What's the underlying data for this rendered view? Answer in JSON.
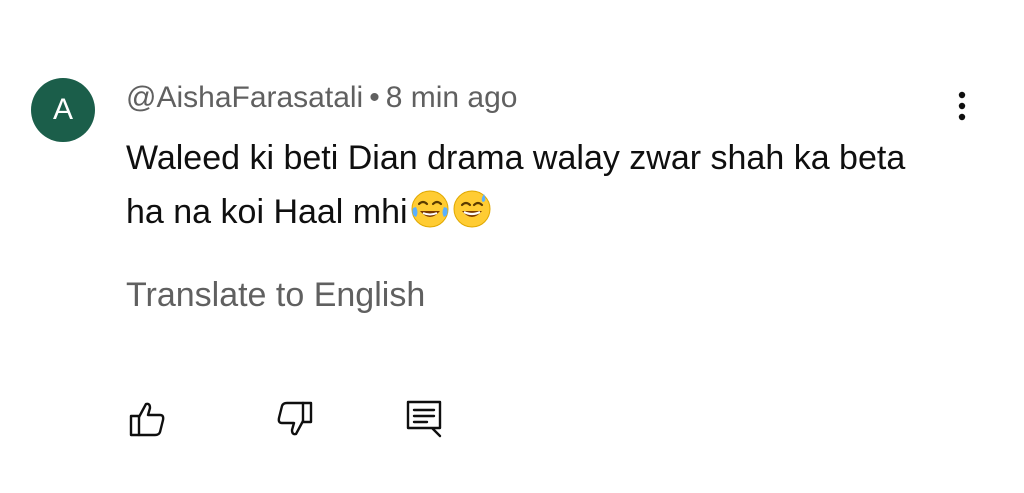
{
  "comment": {
    "avatar": {
      "initial": "A",
      "color": "#1b5e4a"
    },
    "author": "@AishaFarasatali",
    "separator": "•",
    "time": "8 min ago",
    "text": "Waleed ki beti Dian drama walay zwar shah ka beta   ha na koi Haal mhi",
    "emojis": [
      "face-with-tears-of-joy",
      "grinning-face-with-sweat"
    ],
    "translate_label": "Translate to English"
  },
  "actions": {
    "like_icon": "thumbs-up-icon",
    "dislike_icon": "thumbs-down-icon",
    "reply_icon": "reply-icon"
  },
  "menu_icon": "more-vert-icon"
}
